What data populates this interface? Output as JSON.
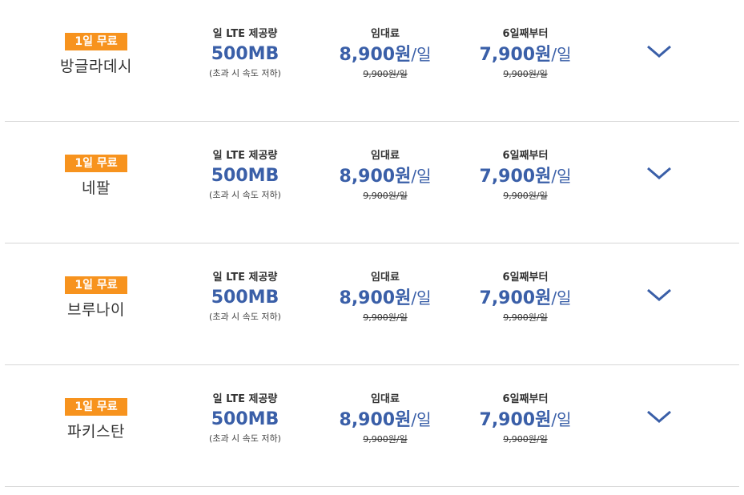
{
  "plans": [
    {
      "badge": "1일 무료",
      "country": "방글라데시",
      "data_label": "일 LTE 제공량",
      "data_value": "500MB",
      "data_note": "(초과 시 속도 저하)",
      "rent_label": "임대료",
      "rent_value": "8,900원",
      "rent_unit": "/일",
      "rent_original": "9,900원/일",
      "after_label": "6일째부터",
      "after_value": "7,900원",
      "after_unit": "/일",
      "after_original": "9,900원/일"
    },
    {
      "badge": "1일 무료",
      "country": "네팔",
      "data_label": "일 LTE 제공량",
      "data_value": "500MB",
      "data_note": "(초과 시 속도 저하)",
      "rent_label": "임대료",
      "rent_value": "8,900원",
      "rent_unit": "/일",
      "rent_original": "9,900원/일",
      "after_label": "6일째부터",
      "after_value": "7,900원",
      "after_unit": "/일",
      "after_original": "9,900원/일"
    },
    {
      "badge": "1일 무료",
      "country": "브루나이",
      "data_label": "일 LTE 제공량",
      "data_value": "500MB",
      "data_note": "(초과 시 속도 저하)",
      "rent_label": "임대료",
      "rent_value": "8,900원",
      "rent_unit": "/일",
      "rent_original": "9,900원/일",
      "after_label": "6일째부터",
      "after_value": "7,900원",
      "after_unit": "/일",
      "after_original": "9,900원/일"
    },
    {
      "badge": "1일 무료",
      "country": "파키스탄",
      "data_label": "일 LTE 제공량",
      "data_value": "500MB",
      "data_note": "(초과 시 속도 저하)",
      "rent_label": "임대료",
      "rent_value": "8,900원",
      "rent_unit": "/일",
      "rent_original": "9,900원/일",
      "after_label": "6일째부터",
      "after_value": "7,900원",
      "after_unit": "/일",
      "after_original": "9,900원/일"
    }
  ],
  "icons": {
    "expand": "chevron-down-icon"
  },
  "colors": {
    "badge": "#f7931e",
    "price": "#3a5fa8",
    "divider": "#d6d6d6"
  }
}
